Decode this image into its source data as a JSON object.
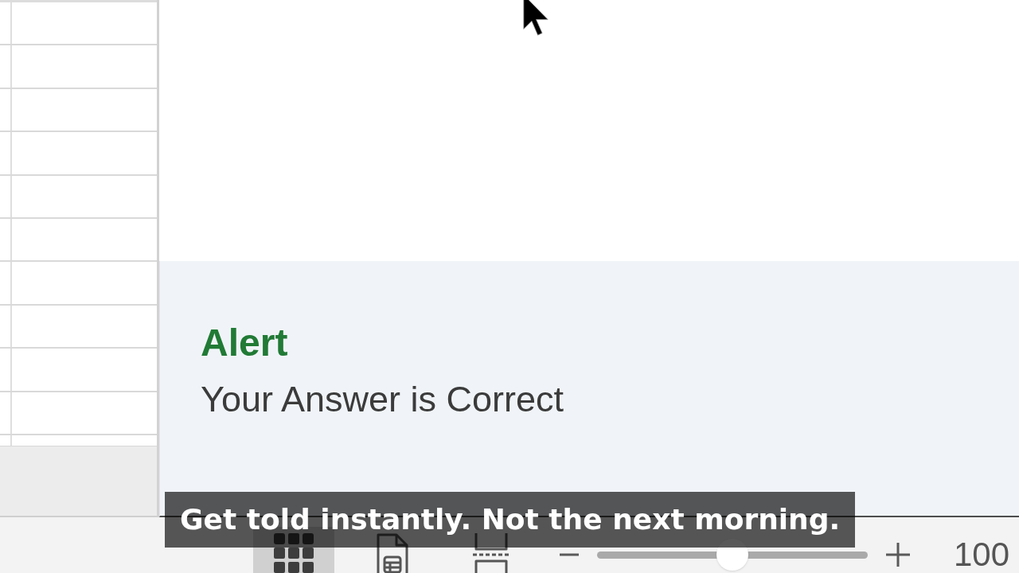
{
  "alert": {
    "title": "Alert",
    "message": "Your Answer is Correct"
  },
  "status_bar": {
    "view_buttons": [
      {
        "kind": "normal",
        "selected": true
      },
      {
        "kind": "page_layout",
        "selected": false
      },
      {
        "kind": "page_break",
        "selected": false
      }
    ],
    "zoom": {
      "level": 0.5,
      "value": "100"
    }
  },
  "caption": "Get told instantly. Not the next morning."
}
